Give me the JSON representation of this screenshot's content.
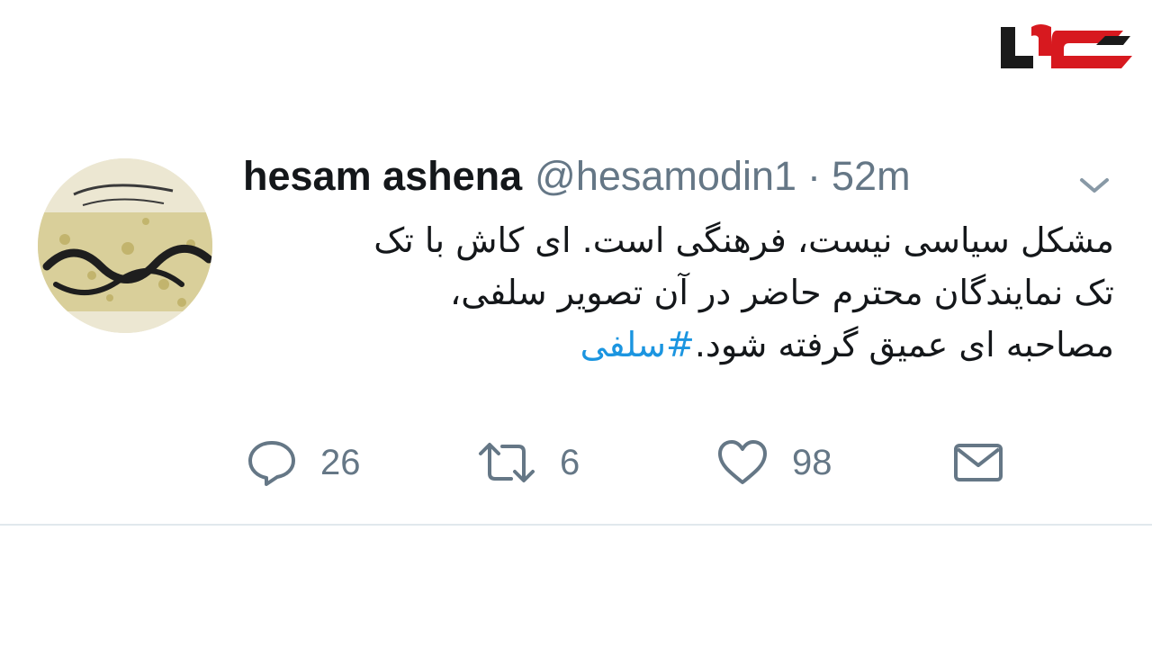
{
  "brand": {
    "logo_icon": "rokna-logo-icon",
    "colors": {
      "red": "#d7191f",
      "black": "#1a1a1a"
    }
  },
  "tweet": {
    "avatar_icon": "calligraphy-avatar-icon",
    "user": {
      "name": "hesam ashena",
      "handle": "@hesamodin1"
    },
    "separator": "·",
    "time": "52m",
    "menu_icon": "chevron-down-icon",
    "text": {
      "line1": "مشکل سیاسی نیست، فرهنگی است. ای کاش با تک",
      "line2": "تک نمایندگان محترم حاضر در آن تصویر سلفی،",
      "line3": "مصاحبه ای عمیق گرفته شود.",
      "hashtag": "#سلفی"
    },
    "actions": {
      "reply": {
        "icon": "reply-icon",
        "count": "26"
      },
      "retweet": {
        "icon": "retweet-icon",
        "count": "6"
      },
      "like": {
        "icon": "heart-icon",
        "count": "98"
      },
      "direct_message": {
        "icon": "envelope-icon"
      }
    },
    "colors": {
      "text": "#14171a",
      "muted": "#657786",
      "link": "#1b95e0",
      "divider": "#e1e8ed"
    }
  }
}
